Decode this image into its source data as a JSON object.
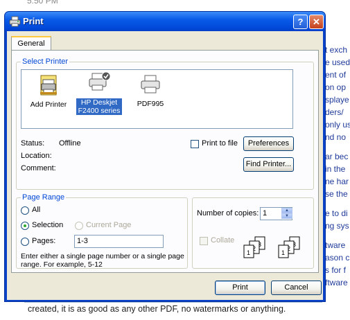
{
  "background": {
    "top_text": "5:50 PM",
    "right_lines": [
      "t exch",
      "e used",
      "ent of",
      "on op",
      "splaye",
      "ders/",
      "only us",
      "nd no",
      "",
      "ar bec",
      "in the",
      "ne har",
      "se the",
      "",
      "e to di",
      "ng sys",
      "",
      "tware",
      "ason c",
      "s for f",
      "ftware"
    ],
    "bottom_text": "created, it is as good as any other PDF, no watermarks or anything."
  },
  "dialog": {
    "title": "Print",
    "help_label": "?",
    "close_label": "✕",
    "tab_general": "General",
    "select_printer": {
      "legend": "Select Printer",
      "printers": [
        {
          "label": "Add Printer",
          "icon": "add-printer-icon"
        },
        {
          "label": "HP Deskjet F2400 series",
          "icon": "printer-default-icon",
          "selected": true
        },
        {
          "label": "PDF995",
          "icon": "printer-icon"
        }
      ],
      "status_label": "Status:",
      "status_value": "Offline",
      "location_label": "Location:",
      "location_value": "",
      "comment_label": "Comment:",
      "comment_value": "",
      "print_to_file": "Print to file",
      "preferences": "Preferences",
      "find_printer": "Find Printer..."
    },
    "page_range": {
      "legend": "Page Range",
      "all": "All",
      "selection": "Selection",
      "current_page": "Current Page",
      "pages": "Pages:",
      "pages_value": "1-3",
      "hint": "Enter either a single page number or a single page range.  For example, 5-12"
    },
    "copies": {
      "label": "Number of copies:",
      "value": "1",
      "collate": "Collate"
    },
    "print_button": "Print",
    "cancel_button": "Cancel"
  }
}
